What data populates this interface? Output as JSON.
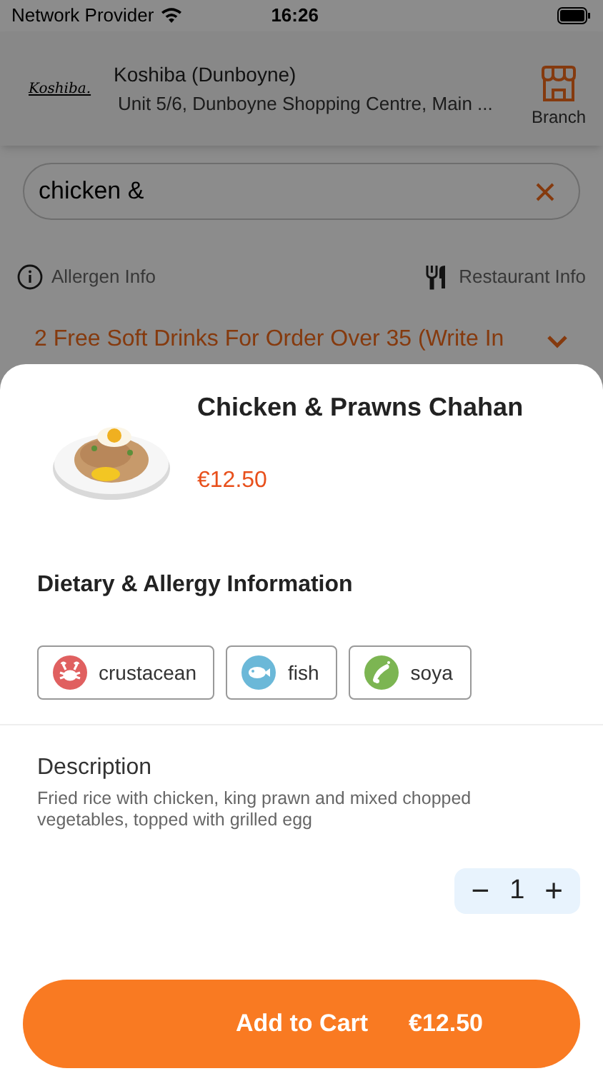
{
  "status_bar": {
    "carrier": "Network Provider",
    "time": "16:26"
  },
  "header": {
    "logo": "Koshiba.",
    "name": "Koshiba (Dunboyne)",
    "address": "Unit 5/6, Dunboyne Shopping Centre, Main ...",
    "branch_label": "Branch"
  },
  "search": {
    "value": "chicken &"
  },
  "info_links": [
    {
      "kind": "allergen",
      "label": "Allergen Info"
    },
    {
      "kind": "restaurant",
      "label": "Restaurant Info"
    }
  ],
  "promo": {
    "text": "2 Free Soft Drinks For Order Over 35 (Write In"
  },
  "item": {
    "title": "Chicken & Prawns Chahan",
    "price": "€12.50"
  },
  "dietary": {
    "heading": "Dietary & Allergy Information",
    "allergens": [
      {
        "kind": "crustacean",
        "label": "crustacean",
        "color": "#e06060"
      },
      {
        "kind": "fish",
        "label": "fish",
        "color": "#6bb8d8"
      },
      {
        "kind": "soya",
        "label": "soya",
        "color": "#7cb552"
      }
    ]
  },
  "description": {
    "heading": "Description",
    "text": "Fried rice with chicken, king prawn and mixed chopped vegetables, topped with grilled egg"
  },
  "quantity": {
    "minus": "−",
    "value": "1",
    "plus": "+"
  },
  "add_to_cart": {
    "label": "Add to Cart",
    "price": "€12.50"
  }
}
